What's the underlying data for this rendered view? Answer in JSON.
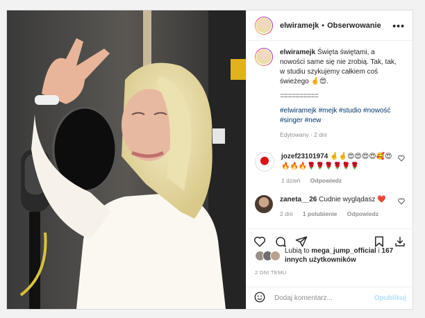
{
  "post": {
    "photo_alt": "",
    "header": {
      "username": "elwiramejk",
      "separator": "•",
      "follow_label": "Obserwowanie",
      "more_label": "•••"
    },
    "caption": {
      "username": "elwiramejk",
      "text": "Święta świętami, a nowości same się nie zrobią. Tak, tak, w studiu szykujemy całkiem coś świeżego 🤞😍.",
      "dots": ":::::::::::::::::::::::::::::::::::::::::::::",
      "hashtags": "#elwiramejk #mejk #studio #nowość #singer #new",
      "meta": "Edytowany · 2 dni"
    },
    "comments": [
      {
        "username": "jozef23101974",
        "text": "🤞🤞😍😍😍😍🥰😍🔥🔥🔥🌹🌹🌹🌹🌹🌹",
        "time": "1 dzień",
        "reply": "Odpowiedz",
        "likes": ""
      },
      {
        "username": "zaneta__26",
        "text": "Cudnie wyglądasz ❤️",
        "time": "2 dni",
        "likes": "1 polubienie",
        "reply": "Odpowiedz"
      }
    ],
    "likes": {
      "prefix": "Lubią to",
      "user": "mega_jump_official",
      "mid": "i",
      "others": "167 innych użytkowników"
    },
    "time_ago": "2 DNI TEMU",
    "comment_box": {
      "placeholder": "Dodaj komentarz...",
      "publish": "Opublikuj"
    }
  }
}
